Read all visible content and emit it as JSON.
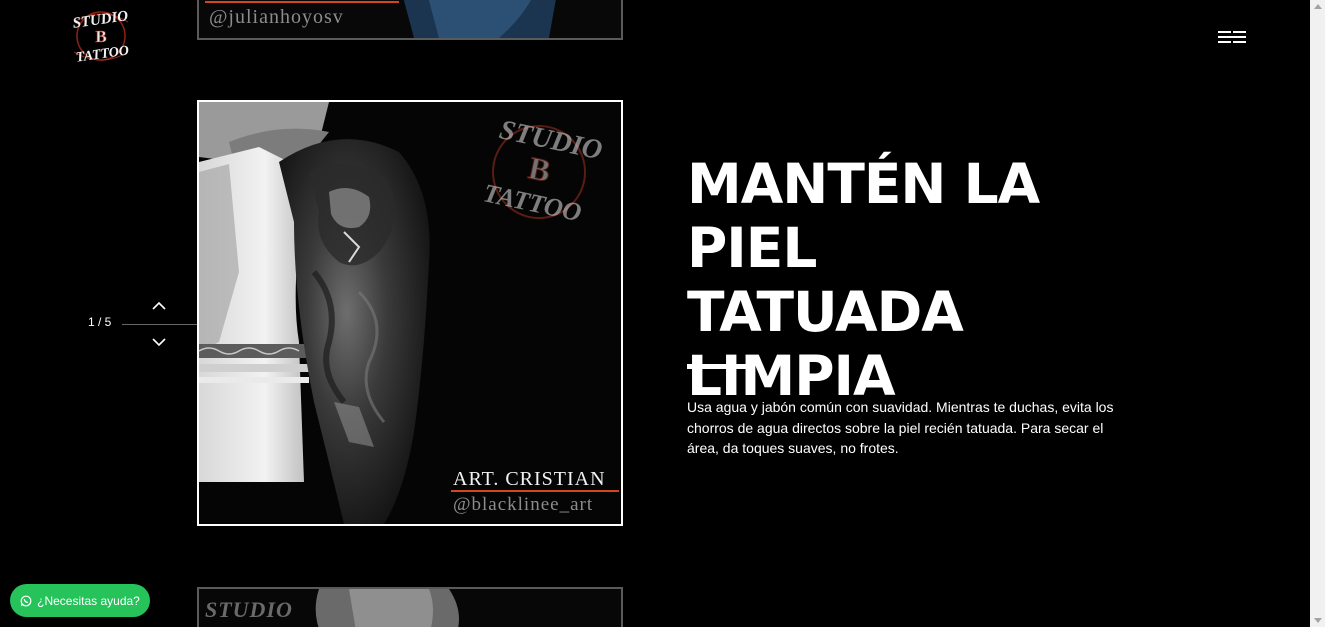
{
  "header": {
    "logo_alt": "Studio B Tattoo",
    "logo_text_top": "STUDIO",
    "logo_text_mid": "B",
    "logo_text_bottom": "TATTOO",
    "menu_icon": "hamburger-icon"
  },
  "gallery": {
    "top_photo": {
      "handle": "@julianhoyosv"
    },
    "main_photo": {
      "artist": "ART. CRISTIAN",
      "handle": "@blacklinee_art",
      "watermark_top": "STUDIO",
      "watermark_mid": "B",
      "watermark_bottom": "TATTOO"
    },
    "bottom_photo": {
      "watermark_top": "STUDIO"
    }
  },
  "pager": {
    "current": "1",
    "total": "5",
    "label": "1 / 5",
    "up_icon": "chevron-up-icon",
    "down_icon": "chevron-down-icon"
  },
  "content": {
    "headline": "MANTÉN LA PIEL TATUADA LIMPIA",
    "body": "Usa agua y jabón común con suavidad. Mientras te duchas, evita los chorros de agua directos sobre la piel recién tatuada. Para secar el área, da toques suaves, no frotes."
  },
  "help_button": {
    "label": "¿Necesitas ayuda?",
    "icon": "whatsapp-icon",
    "color": "#25c35a"
  },
  "colors": {
    "background": "#000000",
    "accent_orange": "#d2461e",
    "text": "#ffffff"
  }
}
